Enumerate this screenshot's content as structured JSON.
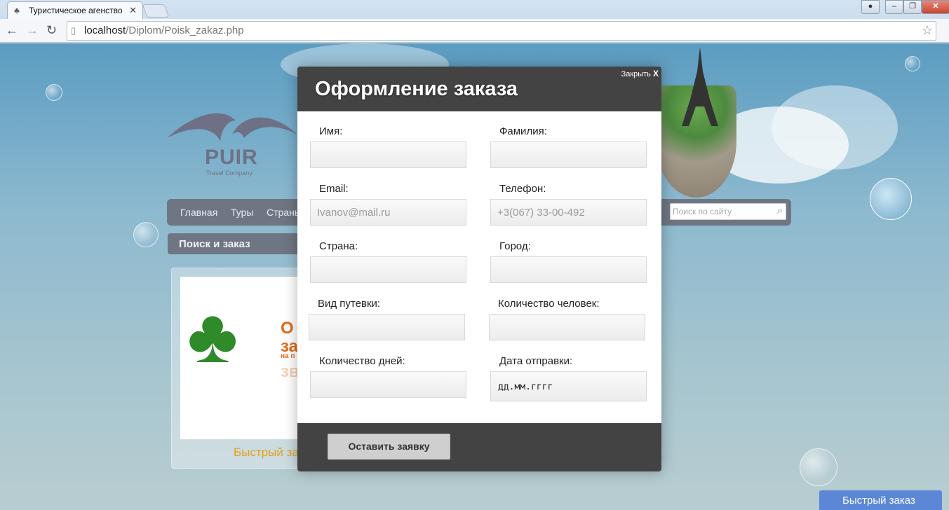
{
  "browser": {
    "tab_title": "Туристическое агенство",
    "tab_close": "✕",
    "url_host": "localhost",
    "url_path": "/Diplom/Poisk_zakaz.php"
  },
  "site": {
    "logo_title": "PUIR",
    "logo_subtitle": "Travel Company",
    "menu": [
      "Главная",
      "Туры",
      "Страны"
    ],
    "search_placeholder": "Поиск по сайту",
    "breadcrumb": "Поиск и заказ",
    "card_caption": "Быстрый заказ",
    "card_promo": [
      "О",
      "за",
      "на п",
      "зв"
    ],
    "quick_order": "Быстрый заказ"
  },
  "modal": {
    "close_label": "Закрыть",
    "close_x": "X",
    "title": "Оформление заказа",
    "fields": {
      "first_name": {
        "label": "Имя:",
        "value": ""
      },
      "last_name": {
        "label": "Фамилия:",
        "value": ""
      },
      "email": {
        "label": "Email:",
        "placeholder": "Ivanov@mail.ru"
      },
      "phone": {
        "label": "Телефон:",
        "placeholder": "+3(067) 33-00-492"
      },
      "country": {
        "label": "Страна:",
        "value": ""
      },
      "city": {
        "label": "Город:",
        "value": ""
      },
      "tour_type": {
        "label": "Вид путевки:",
        "value": ""
      },
      "people_count": {
        "label": "Количество человек:",
        "value": ""
      },
      "days_count": {
        "label": "Количество дней:",
        "value": ""
      },
      "departure_date": {
        "label": "Дата отправки:",
        "placeholder": "дд.мм.гггг"
      }
    },
    "submit_label": "Оставить заявку"
  }
}
